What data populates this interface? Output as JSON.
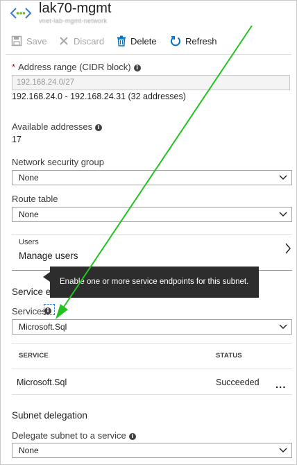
{
  "header": {
    "title": "lak70-mgmt",
    "subtitle": "vnet-lab-mgmt-network"
  },
  "toolbar": {
    "save_label": "Save",
    "discard_label": "Discard",
    "delete_label": "Delete",
    "refresh_label": "Refresh"
  },
  "address_range": {
    "required_mark": "*",
    "label": "Address range (CIDR block)",
    "value": "192.168.24.0/27",
    "summary": "192.168.24.0 - 192.168.24.31 (32 addresses)"
  },
  "available_addresses": {
    "label": "Available addresses",
    "value": "17"
  },
  "network_security_group": {
    "label": "Network security group",
    "selected": "None"
  },
  "route_table": {
    "label": "Route table",
    "selected": "None"
  },
  "users": {
    "caption": "Users",
    "title": "Manage users"
  },
  "service_endpoints": {
    "section_title": "Service e",
    "services_label": "Services",
    "selected": "Microsoft.Sql",
    "tooltip": "Enable one or more service endpoints for this subnet.",
    "table": {
      "columns": [
        "SERVICE",
        "STATUS"
      ],
      "rows": [
        {
          "service": "Microsoft.Sql",
          "status": "Succeeded",
          "more": "..."
        }
      ]
    }
  },
  "subnet_delegation": {
    "section_title": "Subnet delegation",
    "label": "Delegate subnet to a service",
    "selected": "None"
  },
  "colors": {
    "accent_blue": "#0072c6",
    "annotation_green": "#22c31e",
    "tooltip_bg": "#2d2d2d"
  }
}
